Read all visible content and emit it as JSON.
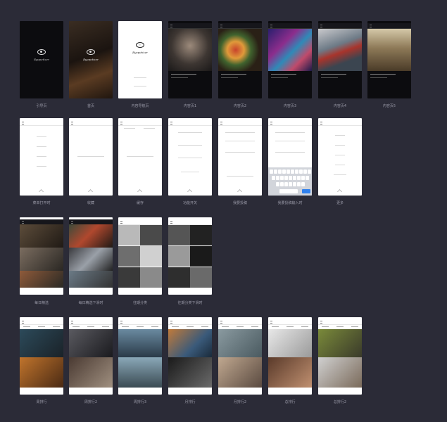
{
  "captions": {
    "r1": [
      "引导页",
      "首页",
      "内容导航页",
      "内容页1",
      "内容页2",
      "内容页3",
      "内容页4",
      "内容页5"
    ],
    "r2": [
      "菜单打开时",
      "收藏",
      "缓存",
      "功能开关",
      "我要投稿",
      "我要投稿输入时",
      "更多"
    ],
    "r3": [
      "每日精选",
      "每日精选下滑时",
      "往期分类",
      "往期分类下滑时"
    ],
    "r4": [
      "周排行",
      "周排行2",
      "周排行3",
      "月排行",
      "月排行2",
      "总排行",
      "总排行2"
    ]
  },
  "brand": "Eyepetizer",
  "colors": {
    "background": "#2b2b37",
    "caption": "#9a9aa8"
  }
}
